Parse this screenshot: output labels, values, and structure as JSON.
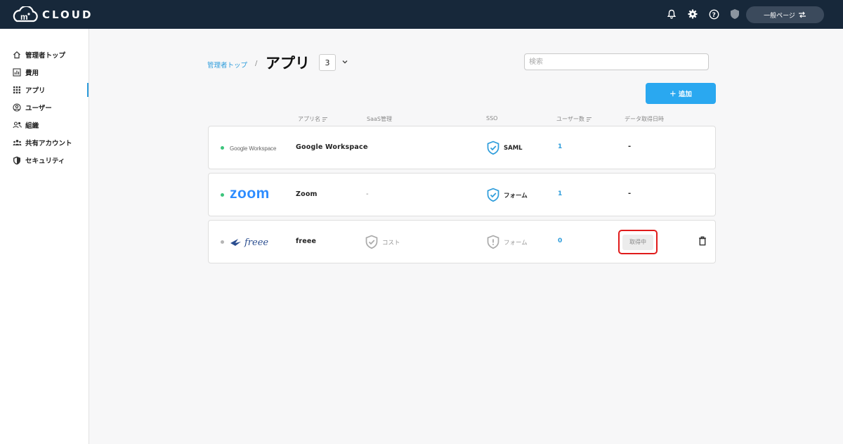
{
  "header": {
    "logo_mark": "m",
    "logo_text": "CLOUD",
    "switch_label": "一般ページ",
    "icons": [
      "bell-icon",
      "gear-icon",
      "help-icon",
      "shield-icon",
      "switch-arrows-icon"
    ]
  },
  "sidebar": {
    "items": [
      {
        "label": "管理者トップ",
        "icon": "home-icon"
      },
      {
        "label": "費用",
        "icon": "bar-chart-icon"
      },
      {
        "label": "アプリ",
        "icon": "apps-grid-icon",
        "active": true
      },
      {
        "label": "ユーザー",
        "icon": "user-circle-icon"
      },
      {
        "label": "組織",
        "icon": "group-icon"
      },
      {
        "label": "共有アカウント",
        "icon": "shared-users-icon"
      },
      {
        "label": "セキュリティ",
        "icon": "shield-icon"
      }
    ]
  },
  "page": {
    "breadcrumb": "管理者トップ",
    "separator": "/",
    "title": "アプリ",
    "count": "3",
    "search_placeholder": "検索",
    "add_label": "＋ 追加"
  },
  "table": {
    "headers": {
      "app_name": "アプリ名",
      "saas": "SaaS管理",
      "sso": "SSO",
      "users": "ユーザー数",
      "fetch_date": "データ取得日時"
    },
    "rows": [
      {
        "logo_text": "Google Workspace",
        "name": "Google Workspace",
        "saas": "-",
        "sso": "SAML",
        "users": "1",
        "fetch_date": "-",
        "status_dot": "#3cc47c"
      },
      {
        "logo_text": "zoom",
        "name": "Zoom",
        "saas": "-",
        "sso": "フォーム",
        "users": "1",
        "fetch_date": "-",
        "status_dot": "#3cc47c"
      },
      {
        "logo_text": "freee",
        "name": "freee",
        "saas": "コスト",
        "sso": "フォーム",
        "users": "0",
        "fetch_status": "取得中",
        "status_dot": "#b5b5b5"
      }
    ]
  },
  "colors": {
    "header_bg": "#17283a",
    "accent": "#2aa8f0",
    "highlight_border": "#e01b1b"
  }
}
